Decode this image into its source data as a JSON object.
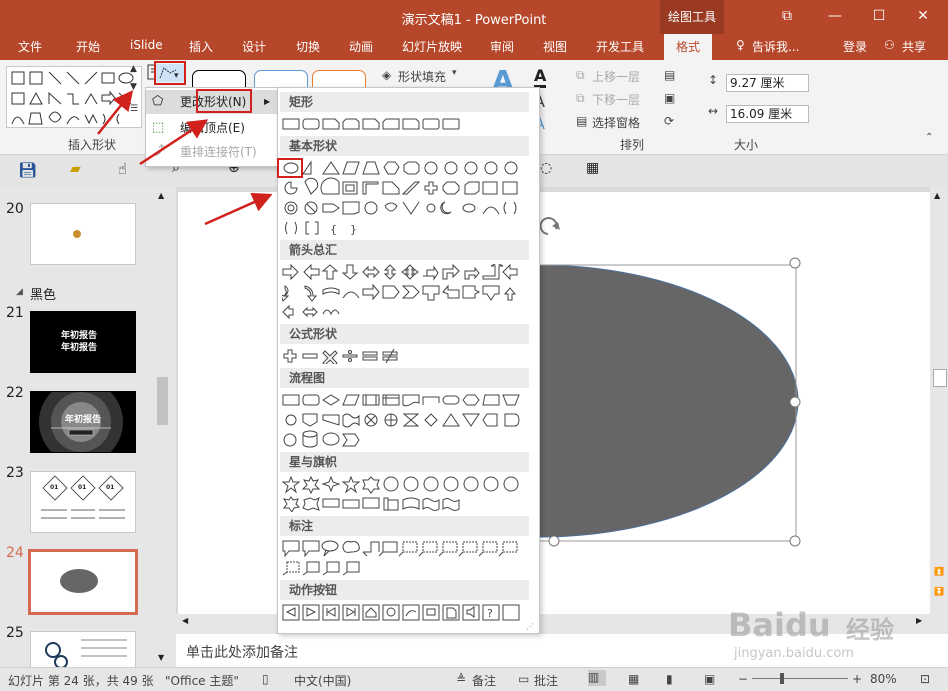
{
  "window": {
    "title": "演示文稿1 - PowerPoint",
    "context_tab": "绘图工具",
    "controls": [
      "⧉",
      "—",
      "☐",
      "✕"
    ]
  },
  "tabs": [
    {
      "label": "文件"
    },
    {
      "label": "开始"
    },
    {
      "label": "iSlide"
    },
    {
      "label": "插入"
    },
    {
      "label": "设计"
    },
    {
      "label": "切换"
    },
    {
      "label": "动画"
    },
    {
      "label": "幻灯片放映"
    },
    {
      "label": "审阅"
    },
    {
      "label": "视图"
    },
    {
      "label": "开发工具"
    },
    {
      "label": "格式"
    }
  ],
  "tab_right": {
    "tell_me": "告诉我...",
    "login": "登录",
    "share": "共享"
  },
  "ribbon": {
    "insert_shapes_label": "插入形状",
    "shape_fill": "形状填充",
    "bring_forward": "上移一层",
    "send_backward": "下移一层",
    "selection_pane": "选择窗格",
    "arrange_label": "排列",
    "size_label": "大小",
    "height": "9.27 厘米",
    "width": "16.09 厘米"
  },
  "edit_menu": {
    "change_shape": "更改形状(N)",
    "edit_points": "编辑顶点(E)",
    "reroute": "重排连接符(T)"
  },
  "shape_menu": {
    "categories": [
      "矩形",
      "基本形状",
      "箭头总汇",
      "公式形状",
      "流程图",
      "星与旗帜",
      "标注",
      "动作按钮"
    ]
  },
  "slides": {
    "section_name": "黑色",
    "items": [
      {
        "num": "20"
      },
      {
        "num": "21",
        "text1": "年初报告",
        "text2": "年初报告"
      },
      {
        "num": "22",
        "text1": "年初报告"
      },
      {
        "num": "23",
        "labels": [
          "01",
          "01",
          "01"
        ]
      },
      {
        "num": "24"
      },
      {
        "num": "25"
      }
    ]
  },
  "notes_placeholder": "单击此处添加备注",
  "status": {
    "slide_info": "幻灯片 第 24 张，共 49 张",
    "theme": "\"Office 主题\"",
    "language": "中文(中国)",
    "notes": "备注",
    "comments": "批注",
    "zoom": "80%"
  },
  "watermark": {
    "brand": "Baidu",
    "brand_cn": "经验",
    "url": "jingyan.baidu.com"
  },
  "colors": {
    "accent": "#b7472a",
    "ellipse_fill": "#666666",
    "highlight_red": "#d0211c"
  }
}
